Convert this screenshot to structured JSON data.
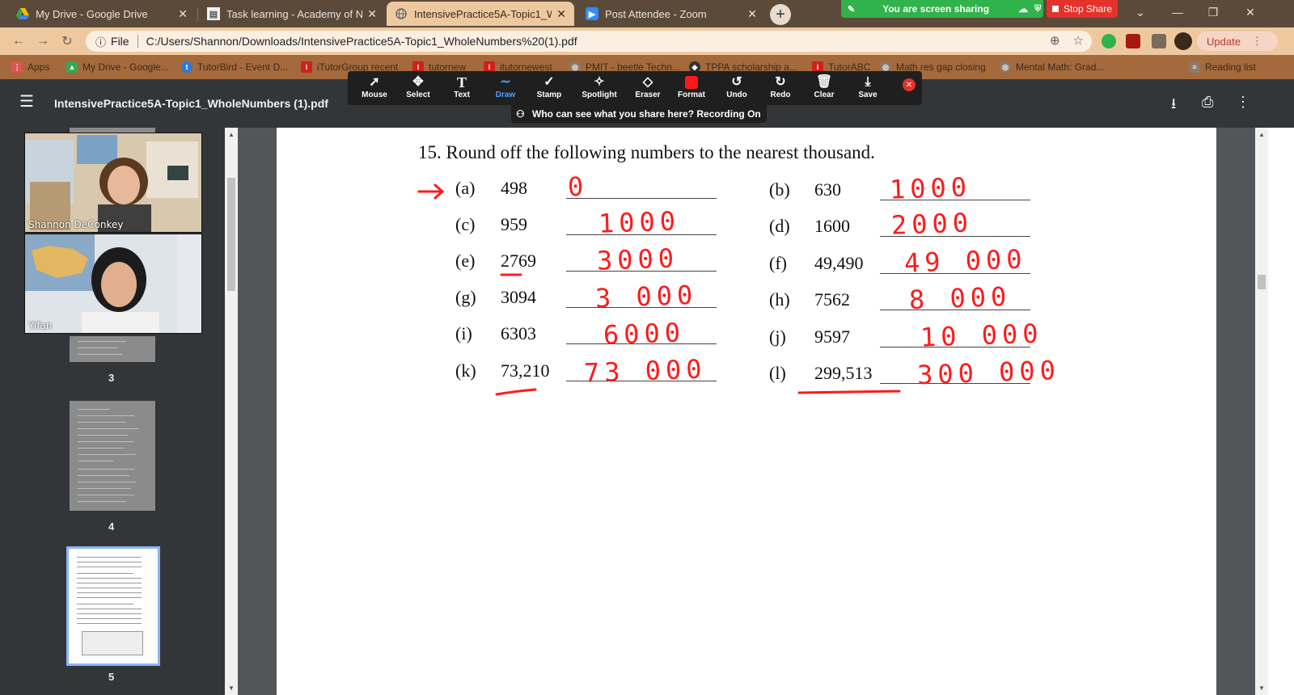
{
  "tabs": [
    {
      "label": "My Drive - Google Drive",
      "icon": "google-drive-icon"
    },
    {
      "label": "Task learning - Academy of New",
      "icon": "academy-icon"
    },
    {
      "label": "IntensivePractice5A-Topic1_Who",
      "icon": "globe-icon"
    },
    {
      "label": "Post Attendee - Zoom",
      "icon": "zoom-icon"
    }
  ],
  "sharing": {
    "status": "You are screen sharing",
    "stop_label": "Stop Share"
  },
  "address": {
    "info_label": "File",
    "url": "C:/Users/Shannon/Downloads/IntensivePractice5A-Topic1_WholeNumbers%20(1).pdf"
  },
  "update_label": "Update",
  "bookmarks": [
    "Apps",
    "My Drive - Google...",
    "TutorBird - Event D...",
    "iTutorGroup recent",
    "tutornew",
    "itutornewest",
    "PMIT - beetle Techn...",
    "TPPA scholarship a...",
    "TutorABC",
    "Math res gap closing",
    "Mental Math: Grad...",
    "Reading list"
  ],
  "pdf": {
    "title": "IntensivePractice5A-Topic1_WholeNumbers (1).pdf"
  },
  "zoom_tools": [
    "Mouse",
    "Select",
    "Text",
    "Draw",
    "Stamp",
    "Spotlight",
    "Eraser",
    "Format",
    "Undo",
    "Redo",
    "Clear",
    "Save"
  ],
  "recording_notice": "Who can see what you share here? Recording On",
  "participants": [
    {
      "name": "Shannon DeConkey"
    },
    {
      "name": "Yifan"
    }
  ],
  "page_numbers": [
    "3",
    "4",
    "5"
  ],
  "question": {
    "title": "15.  Round off the following numbers to the nearest thousand.",
    "items": [
      {
        "label": "(a)",
        "number": "498",
        "answer": "0"
      },
      {
        "label": "(b)",
        "number": "630",
        "answer": "1000"
      },
      {
        "label": "(c)",
        "number": "959",
        "answer": "1000"
      },
      {
        "label": "(d)",
        "number": "1600",
        "answer": "2000"
      },
      {
        "label": "(e)",
        "number": "2769",
        "answer": "3000"
      },
      {
        "label": "(f)",
        "number": "49,490",
        "answer": "49 000"
      },
      {
        "label": "(g)",
        "number": "3094",
        "answer": "3 000"
      },
      {
        "label": "(h)",
        "number": "7562",
        "answer": "8 000"
      },
      {
        "label": "(i)",
        "number": "6303",
        "answer": "6000"
      },
      {
        "label": "(j)",
        "number": "9597",
        "answer": "10 000"
      },
      {
        "label": "(k)",
        "number": "73,210",
        "answer": "73 000"
      },
      {
        "label": "(l)",
        "number": "299,513",
        "answer": "300 000"
      }
    ]
  },
  "colors": {
    "annotation": "#ff1a1a",
    "share_green": "#2fb34a",
    "stop_red": "#e4322b",
    "toolbar": "#eec9a0"
  }
}
